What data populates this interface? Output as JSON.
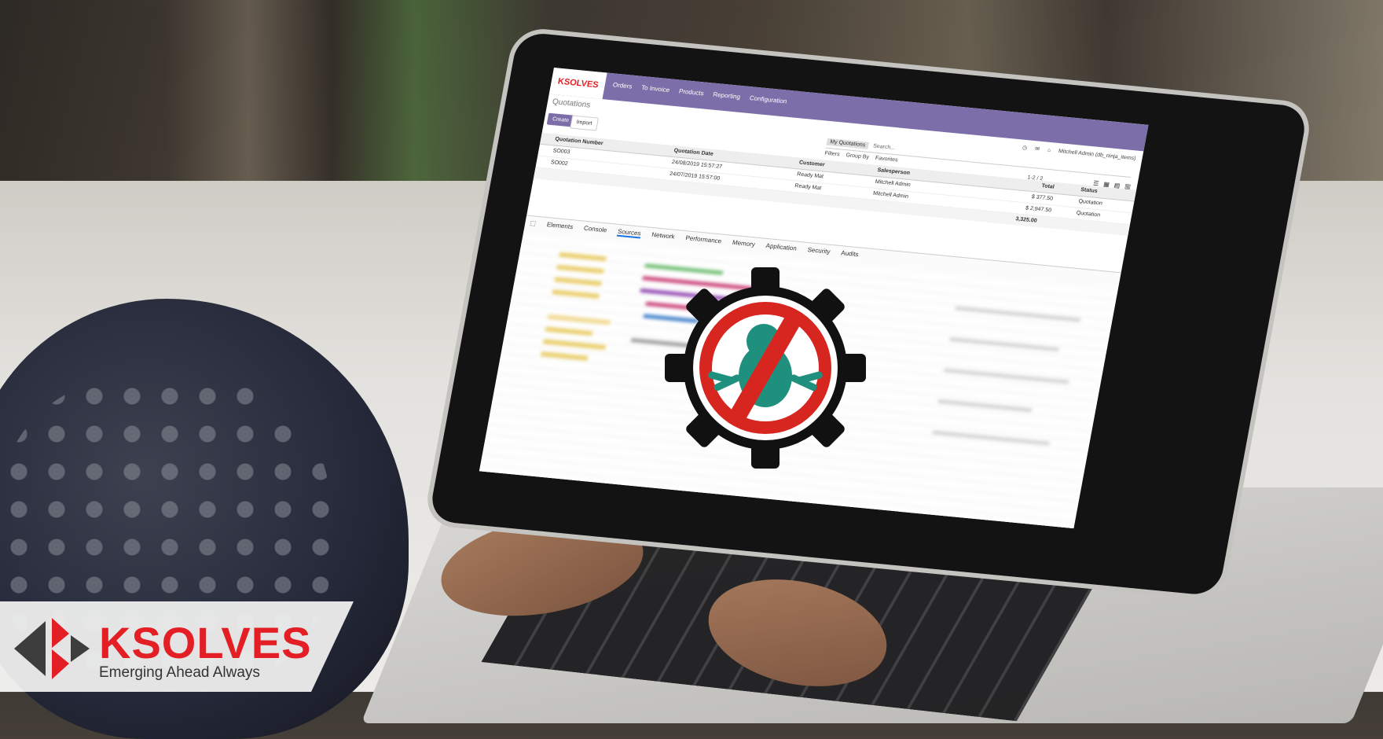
{
  "app": {
    "brand": "KSOLVES",
    "brand_sub": "Emerging Ahead Always",
    "menu": [
      "Orders",
      "To Invoice",
      "Products",
      "Reporting",
      "Configuration"
    ],
    "breadcrumb": "Quotations",
    "create_label": "Create",
    "import_label": "Import",
    "user": "Mitchell Admin (db_ninja_items)",
    "search": {
      "facet": "My Quotations",
      "placeholder": "Search..."
    },
    "filters": [
      "Filters",
      "Group By",
      "Favorites"
    ],
    "pager": "1-2 / 2",
    "table": {
      "headers": [
        "Quotation Number",
        "Quotation Date",
        "Customer",
        "Salesperson",
        "Total",
        "Status"
      ],
      "rows": [
        {
          "number": "SO003",
          "date": "24/08/2019 15:57:27",
          "customer": "Ready Mat",
          "salesperson": "Mitchell Admin",
          "total": "$ 377.50",
          "status": "Quotation"
        },
        {
          "number": "SO002",
          "date": "24/07/2019 15:57:00",
          "customer": "Ready Mat",
          "salesperson": "Mitchell Admin",
          "total": "$ 2,947.50",
          "status": "Quotation"
        }
      ],
      "grand_total": "3,325.00"
    }
  },
  "devtools": {
    "tabs": [
      "Elements",
      "Console",
      "Sources",
      "Network",
      "Performance",
      "Memory",
      "Application",
      "Security",
      "Audits"
    ],
    "active_tab": "Sources"
  },
  "overlay": {
    "icon": "no-bug-gear-icon"
  },
  "banner": {
    "name": "KSOLVES",
    "tagline": "Emerging Ahead Always",
    "color": "#e31e24"
  }
}
